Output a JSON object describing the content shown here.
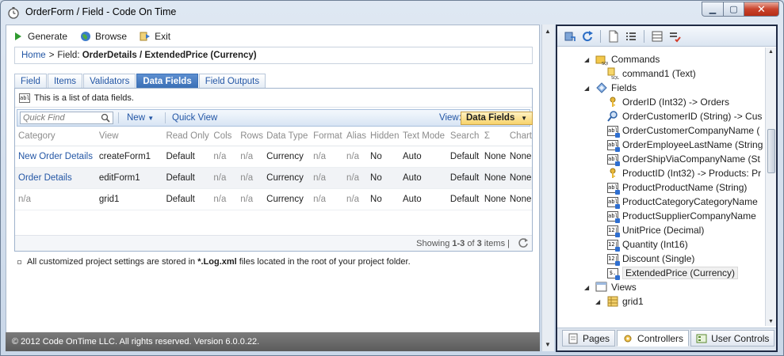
{
  "window": {
    "title": "OrderForm / Field - Code On Time"
  },
  "toolbar": {
    "generate": "Generate",
    "browse": "Browse",
    "exit": "Exit"
  },
  "breadcrumb": {
    "home": "Home",
    "separator": ">",
    "field_label": "Field:",
    "field_value": "OrderDetails / ExtendedPrice (Currency)"
  },
  "tabs": [
    "Field",
    "Items",
    "Validators",
    "Data Fields",
    "Field Outputs"
  ],
  "active_tab": "Data Fields",
  "grid": {
    "description": "This is a list of data fields.",
    "quick_find_placeholder": "Quick Find",
    "new_label": "New",
    "new_arrow": "▼",
    "quick_view": "Quick View",
    "view_label": "View:",
    "view_value": "Data Fields",
    "columns": [
      "Category",
      "View",
      "Read Only",
      "Cols",
      "Rows",
      "Data Type",
      "Format",
      "Alias",
      "Hidden",
      "Text Mode",
      "Search",
      "Σ",
      "Chart"
    ],
    "rows": [
      [
        "New Order Details",
        "createForm1",
        "Default",
        "n/a",
        "n/a",
        "Currency",
        "n/a",
        "n/a",
        "No",
        "Auto",
        "Default",
        "None",
        "None"
      ],
      [
        "Order Details",
        "editForm1",
        "Default",
        "n/a",
        "n/a",
        "Currency",
        "n/a",
        "n/a",
        "No",
        "Auto",
        "Default",
        "None",
        "None"
      ],
      [
        "n/a",
        "grid1",
        "Default",
        "n/a",
        "n/a",
        "Currency",
        "n/a",
        "n/a",
        "No",
        "Auto",
        "Default",
        "None",
        "None"
      ]
    ],
    "pager": {
      "prefix": "Showing ",
      "range": "1-3",
      "of": " of ",
      "total": "3",
      "suffix": " items",
      "divider": "|"
    }
  },
  "note": {
    "prefix": "All customized project settings are stored in ",
    "bold": "*.Log.xml",
    "suffix": " files located in the root of your project folder."
  },
  "footer": "© 2012 Code OnTime LLC. All rights reserved. Version 6.0.0.22.",
  "tree": {
    "commands": "Commands",
    "command1": "command1 (Text)",
    "fields": "Fields",
    "field_items": [
      "OrderID (Int32) -> Orders",
      "OrderCustomerID (String) -> Cus",
      "OrderCustomerCompanyName (",
      "OrderEmployeeLastName (String",
      "OrderShipViaCompanyName (St",
      "ProductID (Int32) -> Products: Pr",
      "ProductProductName (String)",
      "ProductCategoryCategoryName",
      "ProductSupplierCompanyName",
      "UnitPrice (Decimal)",
      "Quantity (Int16)",
      "Discount (Single)",
      "ExtendedPrice (Currency)"
    ],
    "views": "Views",
    "grid1": "grid1"
  },
  "bottom_tabs": [
    "Pages",
    "Controllers",
    "User Controls"
  ],
  "active_bottom_tab": "Controllers"
}
